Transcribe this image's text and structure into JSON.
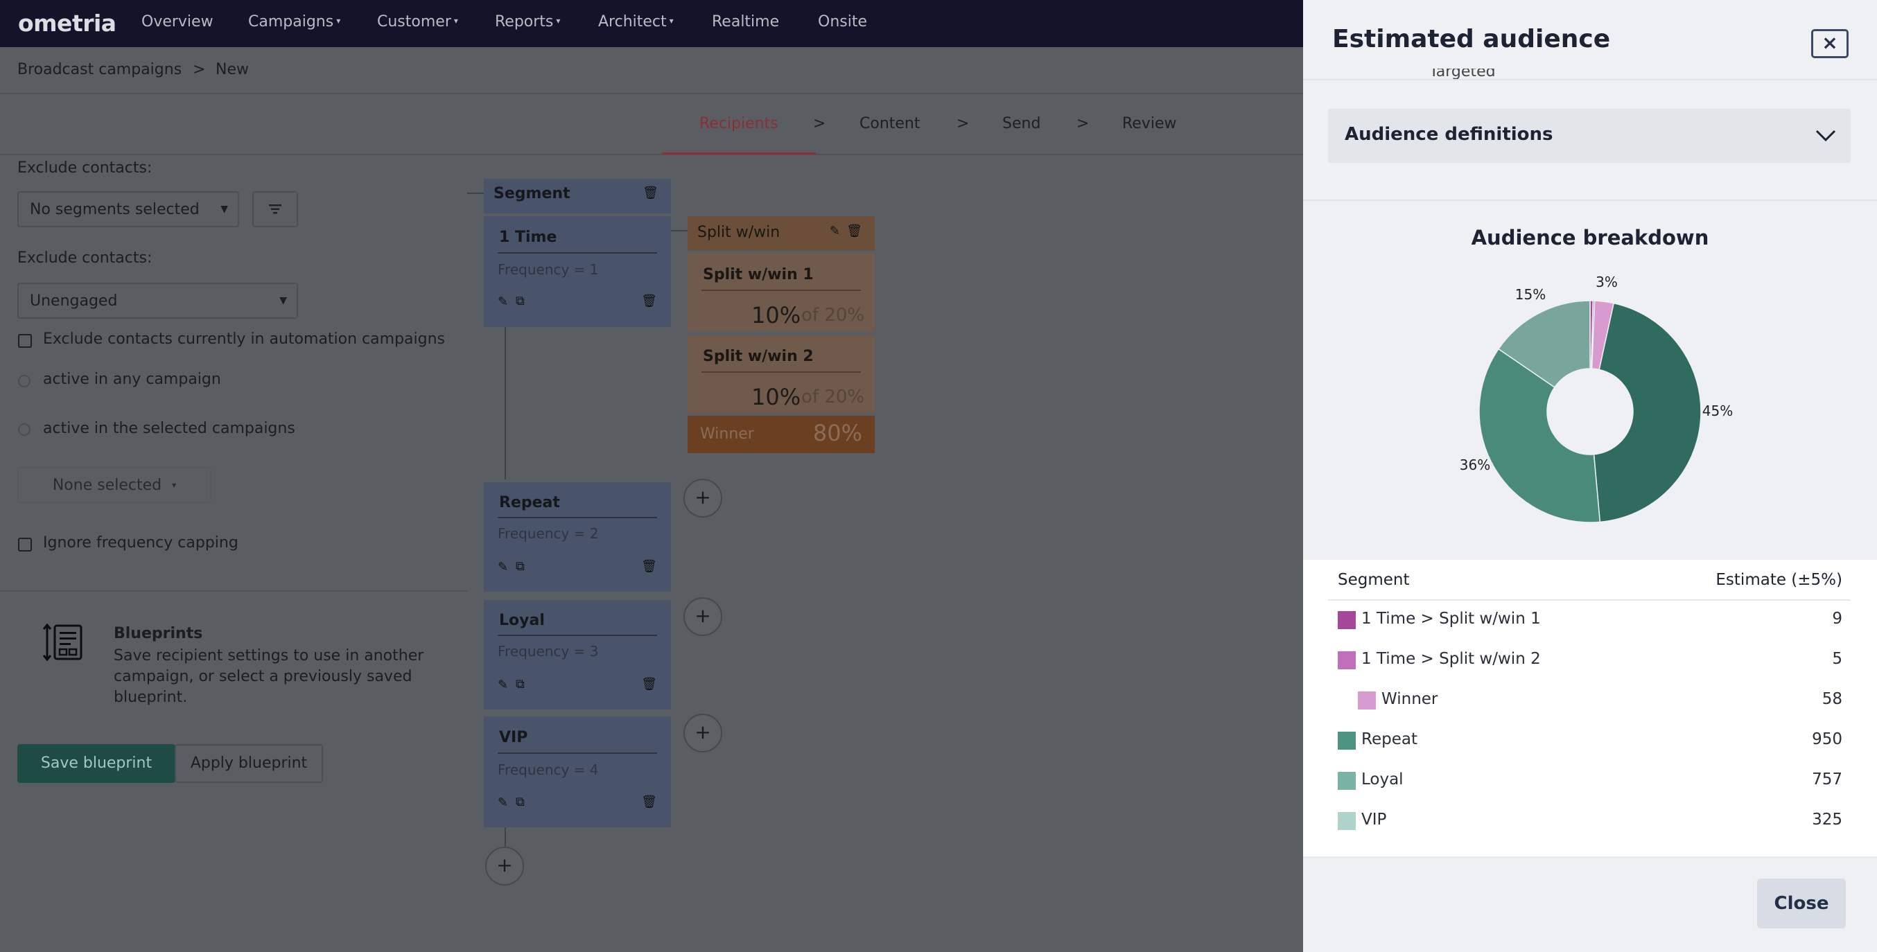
{
  "nav": {
    "logo": "ometria",
    "items": [
      {
        "label": "Overview",
        "caret": false
      },
      {
        "label": "Campaigns",
        "caret": true
      },
      {
        "label": "Customer",
        "caret": true
      },
      {
        "label": "Reports",
        "caret": true
      },
      {
        "label": "Architect",
        "caret": true
      },
      {
        "label": "Realtime",
        "caret": false
      },
      {
        "label": "Onsite",
        "caret": false
      }
    ]
  },
  "breadcrumb": {
    "first": "Broadcast campaigns",
    "sep": ">",
    "second": "New"
  },
  "steps": {
    "items": [
      "Recipients",
      "Content",
      "Send",
      "Review"
    ],
    "sep": ">",
    "active": "Recipients"
  },
  "left": {
    "exclude1_label": "Exclude contacts:",
    "exclude1_value": "No segments selected",
    "exclude2_label": "Exclude contacts:",
    "exclude2_value": "Unengaged",
    "exclude_automation": "Exclude contacts currently in automation campaigns",
    "radio1": "active in any campaign",
    "radio2": "active in the selected campaigns",
    "none_selected": "None selected",
    "ignore_freq": "Ignore frequency capping",
    "blueprints_title": "Blueprints",
    "blueprints_desc_1": "Save recipient settings to use in another",
    "blueprints_desc_2": "campaign, or select a previously saved",
    "blueprints_desc_3": "blueprint.",
    "save_blueprint": "Save blueprint",
    "apply_blueprint": "Apply blueprint"
  },
  "segments": {
    "header": "Segment",
    "cards": [
      {
        "title": "1 Time",
        "freq": "Frequency = 1"
      },
      {
        "title": "Repeat",
        "freq": "Frequency = 2"
      },
      {
        "title": "Loyal",
        "freq": "Frequency = 3"
      },
      {
        "title": "VIP",
        "freq": "Frequency = 4"
      }
    ],
    "plus": "+"
  },
  "split": {
    "title": "Split w/win",
    "items": [
      {
        "title": "Split w/win 1",
        "pct": "10%",
        "of": "of 20%"
      },
      {
        "title": "Split w/win 2",
        "pct": "10%",
        "of": "of 20%"
      }
    ],
    "winner_label": "Winner",
    "winner_pct": "80%"
  },
  "drawer": {
    "title": "Estimated audience",
    "close_x": "×",
    "clipped_text": "Targeted",
    "accordion_label": "Audience definitions",
    "chart_title": "Audience breakdown",
    "table_header_segment": "Segment",
    "table_header_estimate": "Estimate (±5%)",
    "rows": [
      {
        "name": "1 Time > Split w/win 1",
        "value": "9",
        "color": "#a5489a",
        "indent": false
      },
      {
        "name": "1 Time > Split w/win 2",
        "value": "5",
        "color": "#c070b8",
        "indent": false
      },
      {
        "name": "Winner",
        "value": "58",
        "color": "#d79bcf",
        "indent": true
      },
      {
        "name": "Repeat",
        "value": "950",
        "color": "#4f9483",
        "indent": false
      },
      {
        "name": "Loyal",
        "value": "757",
        "color": "#7ab3a4",
        "indent": false
      },
      {
        "name": "VIP",
        "value": "325",
        "color": "#aed3c8",
        "indent": false
      }
    ],
    "close_button": "Close"
  },
  "chart_data": {
    "type": "pie",
    "title": "Audience breakdown",
    "categories": [
      "1 Time > Split w/win 1",
      "1 Time > Split w/win 2",
      "Winner",
      "Repeat",
      "Loyal",
      "VIP"
    ],
    "values": [
      9,
      5,
      58,
      950,
      757,
      325
    ],
    "colors": [
      "#a5489a",
      "#c070b8",
      "#d79bcf",
      "#2f6b5e",
      "#4a8a7a",
      "#7aa59a"
    ],
    "data_labels": [
      {
        "text": "3%"
      },
      {
        "text": "45%"
      },
      {
        "text": "36%"
      },
      {
        "text": "15%"
      }
    ],
    "donut": true
  }
}
